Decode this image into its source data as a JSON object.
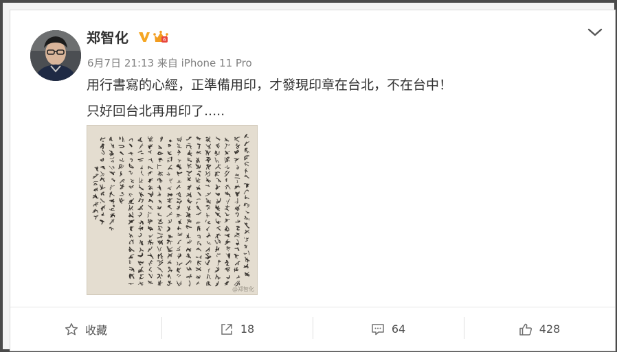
{
  "user": {
    "name": "郑智化",
    "verified_icon": "verified-v-icon",
    "level_icon": "crown-level-icon",
    "meta": "6月7日 21:13 来自 iPhone 11 Pro"
  },
  "post": {
    "line1": "用行書寫的心經，正準備用印，才發現印章在台北，不在台中！",
    "line2": "只好回台北再用印了.....",
    "image_description_icon": "calligraphy-heart-sutra-image",
    "watermark": "@郑智化"
  },
  "actions": [
    {
      "icon": "star-icon",
      "label": "收藏"
    },
    {
      "icon": "share-icon",
      "label": "18"
    },
    {
      "icon": "comment-icon",
      "label": "64"
    },
    {
      "icon": "like-icon",
      "label": "428"
    }
  ],
  "colors": {
    "text_primary": "#333333",
    "text_meta": "#808080",
    "verified": "#f5a623",
    "paper": "#e4ddd0"
  }
}
